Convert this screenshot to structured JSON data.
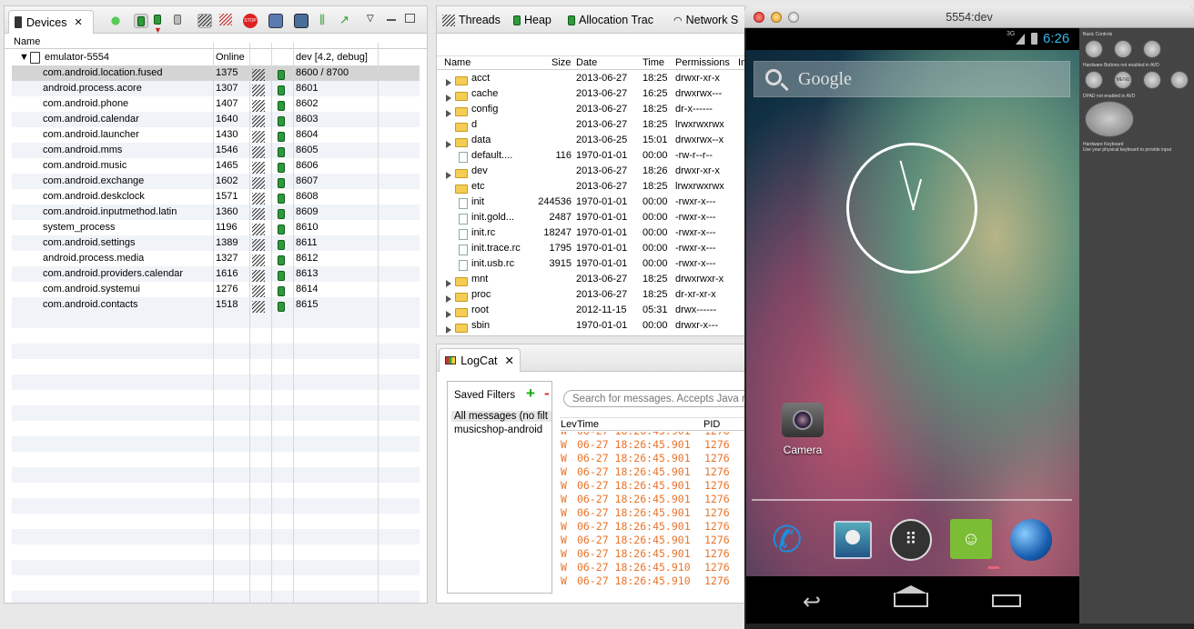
{
  "devices_panel": {
    "tab_label": "Devices",
    "col_name": "Name",
    "device_name": "emulator-5554",
    "device_status": "Online",
    "device_info": "dev [4.2, debug]",
    "processes": [
      {
        "name": "com.android.location.fused",
        "pid": "1375",
        "port": "8600 / 8700"
      },
      {
        "name": "android.process.acore",
        "pid": "1307",
        "port": "8601"
      },
      {
        "name": "com.android.phone",
        "pid": "1407",
        "port": "8602"
      },
      {
        "name": "com.android.calendar",
        "pid": "1640",
        "port": "8603"
      },
      {
        "name": "com.android.launcher",
        "pid": "1430",
        "port": "8604"
      },
      {
        "name": "com.android.mms",
        "pid": "1546",
        "port": "8605"
      },
      {
        "name": "com.android.music",
        "pid": "1465",
        "port": "8606"
      },
      {
        "name": "com.android.exchange",
        "pid": "1602",
        "port": "8607"
      },
      {
        "name": "com.android.deskclock",
        "pid": "1571",
        "port": "8608"
      },
      {
        "name": "com.android.inputmethod.latin",
        "pid": "1360",
        "port": "8609"
      },
      {
        "name": "system_process",
        "pid": "1196",
        "port": "8610"
      },
      {
        "name": "com.android.settings",
        "pid": "1389",
        "port": "8611"
      },
      {
        "name": "android.process.media",
        "pid": "1327",
        "port": "8612"
      },
      {
        "name": "com.android.providers.calendar",
        "pid": "1616",
        "port": "8613"
      },
      {
        "name": "com.android.systemui",
        "pid": "1276",
        "port": "8614"
      },
      {
        "name": "com.android.contacts",
        "pid": "1518",
        "port": "8615"
      }
    ]
  },
  "files_panel": {
    "tabs": [
      "Threads",
      "Heap",
      "Allocation Trac",
      "Network S"
    ],
    "columns": {
      "name": "Name",
      "size": "Size",
      "date": "Date",
      "time": "Time",
      "perm": "Permissions",
      "info": "In"
    },
    "rows": [
      {
        "name": "acct",
        "size": "",
        "date": "2013-06-27",
        "time": "18:25",
        "perm": "drwxr-xr-x",
        "kind": "dir",
        "expand": true
      },
      {
        "name": "cache",
        "size": "",
        "date": "2013-06-27",
        "time": "16:25",
        "perm": "drwxrwx---",
        "kind": "dir",
        "expand": true
      },
      {
        "name": "config",
        "size": "",
        "date": "2013-06-27",
        "time": "18:25",
        "perm": "dr-x------",
        "kind": "dir",
        "expand": true
      },
      {
        "name": "d",
        "size": "",
        "date": "2013-06-27",
        "time": "18:25",
        "perm": "lrwxrwxrwx",
        "kind": "dir",
        "expand": false
      },
      {
        "name": "data",
        "size": "",
        "date": "2013-06-25",
        "time": "15:01",
        "perm": "drwxrwx--x",
        "kind": "dir",
        "expand": true
      },
      {
        "name": "default....",
        "size": "116",
        "date": "1970-01-01",
        "time": "00:00",
        "perm": "-rw-r--r--",
        "kind": "file",
        "expand": false
      },
      {
        "name": "dev",
        "size": "",
        "date": "2013-06-27",
        "time": "18:26",
        "perm": "drwxr-xr-x",
        "kind": "dir",
        "expand": true
      },
      {
        "name": "etc",
        "size": "",
        "date": "2013-06-27",
        "time": "18:25",
        "perm": "lrwxrwxrwx",
        "kind": "dir",
        "expand": false
      },
      {
        "name": "init",
        "size": "244536",
        "date": "1970-01-01",
        "time": "00:00",
        "perm": "-rwxr-x---",
        "kind": "file",
        "expand": false
      },
      {
        "name": "init.gold...",
        "size": "2487",
        "date": "1970-01-01",
        "time": "00:00",
        "perm": "-rwxr-x---",
        "kind": "file",
        "expand": false
      },
      {
        "name": "init.rc",
        "size": "18247",
        "date": "1970-01-01",
        "time": "00:00",
        "perm": "-rwxr-x---",
        "kind": "file",
        "expand": false
      },
      {
        "name": "init.trace.rc",
        "size": "1795",
        "date": "1970-01-01",
        "time": "00:00",
        "perm": "-rwxr-x---",
        "kind": "file",
        "expand": false
      },
      {
        "name": "init.usb.rc",
        "size": "3915",
        "date": "1970-01-01",
        "time": "00:00",
        "perm": "-rwxr-x---",
        "kind": "file",
        "expand": false
      },
      {
        "name": "mnt",
        "size": "",
        "date": "2013-06-27",
        "time": "18:25",
        "perm": "drwxrwxr-x",
        "kind": "dir",
        "expand": true
      },
      {
        "name": "proc",
        "size": "",
        "date": "2013-06-27",
        "time": "18:25",
        "perm": "dr-xr-xr-x",
        "kind": "dir",
        "expand": true
      },
      {
        "name": "root",
        "size": "",
        "date": "2012-11-15",
        "time": "05:31",
        "perm": "drwx------",
        "kind": "dir",
        "expand": true
      },
      {
        "name": "sbin",
        "size": "",
        "date": "1970-01-01",
        "time": "00:00",
        "perm": "drwxr-x---",
        "kind": "dir",
        "expand": true
      }
    ]
  },
  "logcat": {
    "tab_label": "LogCat",
    "saved_filters_label": "Saved Filters",
    "filters": [
      "All messages (no filt",
      "musicshop-android"
    ],
    "search_placeholder": "Search for messages. Accepts Java r",
    "columns": {
      "level": "Lev",
      "time": "Time",
      "pid": "PID"
    },
    "entries": [
      {
        "level": "W",
        "time": "06-27 18:26:45.901",
        "pid": "1276"
      },
      {
        "level": "W",
        "time": "06-27 18:26:45.901",
        "pid": "1276"
      },
      {
        "level": "W",
        "time": "06-27 18:26:45.901",
        "pid": "1276"
      },
      {
        "level": "W",
        "time": "06-27 18:26:45.901",
        "pid": "1276"
      },
      {
        "level": "W",
        "time": "06-27 18:26:45.901",
        "pid": "1276"
      },
      {
        "level": "W",
        "time": "06-27 18:26:45.901",
        "pid": "1276"
      },
      {
        "level": "W",
        "time": "06-27 18:26:45.901",
        "pid": "1276"
      },
      {
        "level": "W",
        "time": "06-27 18:26:45.901",
        "pid": "1276"
      },
      {
        "level": "W",
        "time": "06-27 18:26:45.901",
        "pid": "1276"
      },
      {
        "level": "W",
        "time": "06-27 18:26:45.901",
        "pid": "1276"
      },
      {
        "level": "W",
        "time": "06-27 18:26:45.910",
        "pid": "1276"
      },
      {
        "level": "W",
        "time": "06-27 18:26:45.910",
        "pid": "1276"
      }
    ]
  },
  "emulator": {
    "title": "5554:dev",
    "status_time": "6:26",
    "network": "3G",
    "search_text": "Google",
    "camera_label": "Camera",
    "controls": {
      "basic": "Basic Controls",
      "hw_buttons": "Hardware Buttons not enabled in AVD",
      "dpad": "DPAD not enabled in AVD",
      "keyboard": "Hardware Keyboard",
      "keyboard_hint": "Use your physical keyboard to provide input",
      "menu": "MENU"
    }
  },
  "colors": {
    "log_warn": "#e9742b",
    "heap_green": "#2e9a3a",
    "accent_blue": "#33b5e5"
  }
}
